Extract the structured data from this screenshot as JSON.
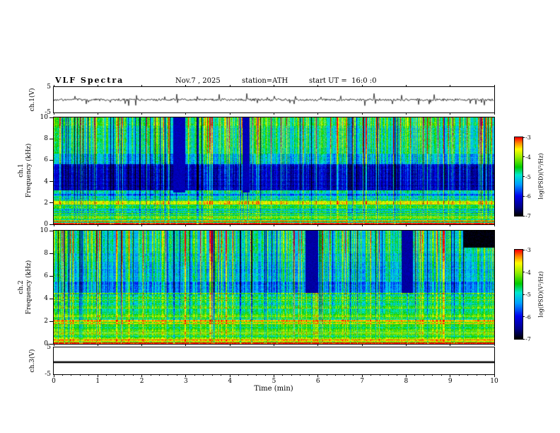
{
  "title": "VLF Spectra",
  "header": {
    "date": "Nov.7 , 2025",
    "station": "station=ATH",
    "start_ut": "start UT =  16:0 :0"
  },
  "panels": {
    "ch1_wave": {
      "label": "ch.1(V)",
      "ymax": "5",
      "ymin": "-5"
    },
    "ch1_spec": {
      "ch": "ch.1",
      "freq": "Frequency (kHz)"
    },
    "ch2_spec": {
      "ch": "ch.2",
      "freq": "Frequency (kHz)"
    },
    "ch3_wave": {
      "label": "ch.3(V)",
      "ymax": "5",
      "ymin": "-5"
    }
  },
  "xaxis": {
    "label": "Time (min)",
    "ticks": [
      0,
      1,
      2,
      3,
      4,
      5,
      6,
      7,
      8,
      9,
      10
    ],
    "minor_step": 0.2
  },
  "freq_axis": {
    "ticks": [
      0,
      2,
      4,
      6,
      8,
      10
    ],
    "max": 10
  },
  "colorbar": {
    "label": "log(PSD)(V²/Hz)",
    "ticks": [
      "-3",
      "-4",
      "-5",
      "-6",
      "-7"
    ],
    "stops": [
      [
        0,
        "#000000"
      ],
      [
        0.1,
        "#000080"
      ],
      [
        0.25,
        "#0000ee"
      ],
      [
        0.4,
        "#00a0ff"
      ],
      [
        0.52,
        "#00e8d0"
      ],
      [
        0.62,
        "#00cc00"
      ],
      [
        0.75,
        "#99ee00"
      ],
      [
        0.85,
        "#ffff00"
      ],
      [
        0.93,
        "#ff8800"
      ],
      [
        1,
        "#ff0000"
      ]
    ]
  },
  "chart_data": [
    {
      "type": "line",
      "name": "ch1_waveform",
      "ylabel": "ch.1(V)",
      "xlabel": "Time (min)",
      "xlim": [
        0,
        10
      ],
      "ylim": [
        -5,
        5
      ],
      "seed": 9,
      "noise_v": 0.45,
      "spike_prob": 0.05,
      "spike_v": 2.2,
      "description": "broadband noise around 0 V with impulsive sferic spikes up to about ±4 V for the full 10 minutes"
    },
    {
      "type": "heatmap",
      "name": "ch1_spectrogram",
      "ylabel": "Frequency (kHz)",
      "xlabel": "Time (min)",
      "xlim": [
        0,
        10
      ],
      "ylim": [
        0,
        10
      ],
      "vlim": [
        -7,
        -3
      ],
      "value_label": "log(PSD)(V²/Hz)",
      "seed": 101,
      "pix_noise": 0.5,
      "row_noise": [
        3.2,
        0.5,
        0.15
      ],
      "stripes": {
        "strong": 0.1,
        "med": 0.35,
        "weak": 0.6,
        "dark": 0.66
      },
      "bands": [
        [
          0,
          0.1,
          -3.4
        ],
        [
          0.1,
          0.25,
          -4.6
        ],
        [
          0.25,
          0.4,
          -3.7
        ],
        [
          0.4,
          0.55,
          -4.9
        ],
        [
          0.55,
          0.75,
          -4.3
        ],
        [
          0.75,
          1.05,
          -4.7
        ],
        [
          1.05,
          1.55,
          -5.2
        ],
        [
          1.55,
          1.85,
          -4.8
        ],
        [
          1.85,
          2.2,
          -4.2
        ],
        [
          2.2,
          2.6,
          -5.0
        ],
        [
          2.6,
          3.2,
          -5.5
        ],
        [
          3.2,
          5.6,
          -6.5
        ],
        [
          5.6,
          6.6,
          -5.5
        ],
        [
          6.6,
          9.2,
          -5.15
        ],
        [
          9.2,
          10.01,
          -4.95
        ]
      ],
      "features": [
        {
          "t0": 2.72,
          "t1": 2.98,
          "f0": 3,
          "f1": 10.01,
          "v": -6.3
        },
        {
          "t0": 4.28,
          "t1": 4.44,
          "f0": 3,
          "f1": 10.01,
          "v": -6.3
        }
      ],
      "description": "dense vertical sferic stripes across all frequencies; quiet dark-blue band 3.2-5.6 kHz; strong horizontal power-line bands below 1 kHz and near 2 kHz; brightest (red) activity near 10 kHz"
    },
    {
      "type": "heatmap",
      "name": "ch2_spectrogram",
      "ylabel": "Frequency (kHz)",
      "xlabel": "Time (min)",
      "xlim": [
        0,
        10
      ],
      "ylim": [
        0,
        10
      ],
      "vlim": [
        -7,
        -3
      ],
      "value_label": "log(PSD)(V²/Hz)",
      "seed": 202,
      "pix_noise": 0.5,
      "row_noise": [
        4.5,
        0.55,
        0.18
      ],
      "stripes": {
        "strong": 0.1,
        "med": 0.35,
        "weak": 0.6,
        "dark": 0.67
      },
      "bands": [
        [
          0,
          0.1,
          -3.4
        ],
        [
          0.1,
          0.3,
          -4.2
        ],
        [
          0.3,
          0.45,
          -3.7
        ],
        [
          0.45,
          0.7,
          -4.5
        ],
        [
          0.7,
          1.15,
          -4.35
        ],
        [
          1.15,
          1.75,
          -4.7
        ],
        [
          1.75,
          2.1,
          -3.95
        ],
        [
          2.1,
          2.5,
          -4.55
        ],
        [
          2.5,
          3.5,
          -4.8
        ],
        [
          3.5,
          4.5,
          -5.0
        ],
        [
          4.5,
          5.5,
          -5.7
        ],
        [
          5.5,
          8,
          -5.4
        ],
        [
          8,
          10.01,
          -5.2
        ]
      ],
      "features": [
        {
          "t0": 9.3,
          "t1": 10.01,
          "f0": 8.5,
          "f1": 10.01,
          "v": -7
        },
        {
          "t0": 5.72,
          "t1": 6.0,
          "f0": 4.5,
          "f1": 10.01,
          "v": -6.4
        },
        {
          "t0": 7.9,
          "t1": 8.15,
          "f0": 4.5,
          "f1": 10.01,
          "v": -6.4
        }
      ],
      "description": "strongly striated green/cyan horizontal lines below ~4.5 kHz, yellow band near 2 kHz, vertical sferic stripes above 4.5 kHz with dark-blue dropouts and a black patch at the top-right corner"
    },
    {
      "type": "line",
      "name": "ch3_waveform",
      "ylabel": "ch.3(V)",
      "xlabel": "Time (min)",
      "xlim": [
        0,
        10
      ],
      "ylim": [
        -5,
        5
      ],
      "flat_v": -0.5,
      "description": "flat constant trace near 0 V (inactive channel)"
    }
  ]
}
